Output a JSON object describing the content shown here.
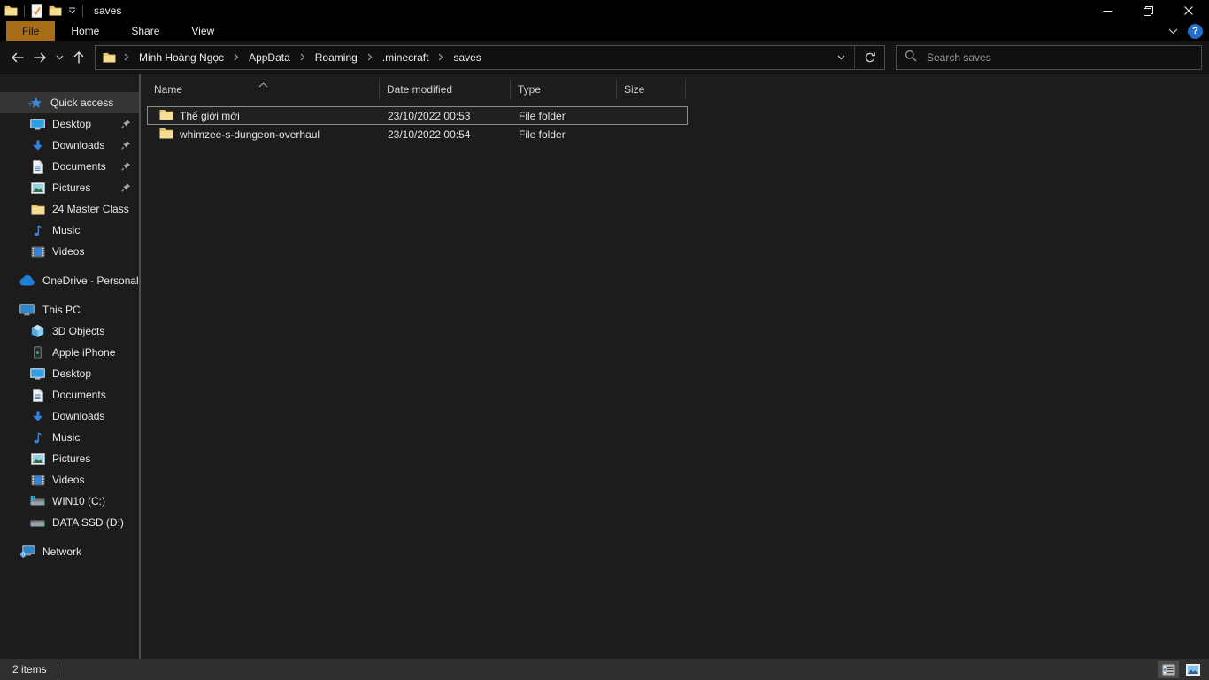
{
  "window": {
    "title": "saves"
  },
  "titlebar": {
    "qat_icons": [
      "app-folder-icon",
      "properties-icon",
      "new-folder-icon",
      "customize-qat-chevron"
    ],
    "controls": [
      "minimize",
      "restore",
      "close"
    ]
  },
  "ribbon": {
    "tabs": [
      "File",
      "Home",
      "Share",
      "View"
    ],
    "active_tab": "File",
    "help_label": "?",
    "icons": [
      "minimize-ribbon-chevron",
      "help-icon"
    ]
  },
  "navigation": {
    "buttons": [
      "back",
      "forward",
      "recent-locations",
      "up"
    ],
    "breadcrumb": [
      "Minh Hoàng Ngọc",
      "AppData",
      "Roaming",
      ".minecraft",
      "saves"
    ],
    "address_icons": [
      "folder-icon",
      "dropdown-chevron",
      "refresh-icon"
    ],
    "search_placeholder": "Search saves",
    "search_icon": "magnifier"
  },
  "sidebar": {
    "quick_access": {
      "label": "Quick access",
      "icon": "star",
      "selected": true,
      "items": [
        {
          "label": "Desktop",
          "icon": "monitor",
          "pinned": true
        },
        {
          "label": "Downloads",
          "icon": "download-arrow",
          "pinned": true
        },
        {
          "label": "Documents",
          "icon": "document",
          "pinned": true
        },
        {
          "label": "Pictures",
          "icon": "picture",
          "pinned": true
        },
        {
          "label": "24 Master Class",
          "icon": "folder",
          "pinned": false
        },
        {
          "label": "Music",
          "icon": "music-note",
          "pinned": false
        },
        {
          "label": "Videos",
          "icon": "film",
          "pinned": false
        }
      ]
    },
    "onedrive": {
      "label": "OneDrive - Personal",
      "icon": "cloud"
    },
    "this_pc": {
      "label": "This PC",
      "icon": "computer",
      "items": [
        {
          "label": "3D Objects",
          "icon": "cube"
        },
        {
          "label": "Apple iPhone",
          "icon": "phone"
        },
        {
          "label": "Desktop",
          "icon": "monitor"
        },
        {
          "label": "Documents",
          "icon": "document"
        },
        {
          "label": "Downloads",
          "icon": "download-arrow"
        },
        {
          "label": "Music",
          "icon": "music-note"
        },
        {
          "label": "Pictures",
          "icon": "picture"
        },
        {
          "label": "Videos",
          "icon": "film"
        },
        {
          "label": "WIN10 (C:)",
          "icon": "drive-windows"
        },
        {
          "label": "DATA SSD (D:)",
          "icon": "drive"
        }
      ]
    },
    "network": {
      "label": "Network",
      "icon": "network"
    }
  },
  "main": {
    "columns": [
      "Name",
      "Date modified",
      "Type",
      "Size"
    ],
    "sort": {
      "column": "Name",
      "direction": "ascending"
    },
    "rows": [
      {
        "name": "Thế giới mới",
        "date_modified": "23/10/2022 00:53",
        "type": "File folder",
        "size": "",
        "icon": "folder",
        "selected": true
      },
      {
        "name": "whimzee-s-dungeon-overhaul",
        "date_modified": "23/10/2022 00:54",
        "type": "File folder",
        "size": "",
        "icon": "folder",
        "selected": false
      }
    ]
  },
  "statusbar": {
    "items_count": "2 items",
    "views": [
      "details-view",
      "thumbnail-view"
    ],
    "active_view": "details-view"
  },
  "colors": {
    "file_tab_accent": "#a86e17",
    "help_blue": "#2170c8",
    "folder_front": "#f5dd94",
    "folder_back": "#e6c36a",
    "selection_outline": "#8c8c8c",
    "titlebar_bg": "#000000",
    "content_bg": "#1c1c1c",
    "statusbar_bg": "#2f2f2f"
  }
}
